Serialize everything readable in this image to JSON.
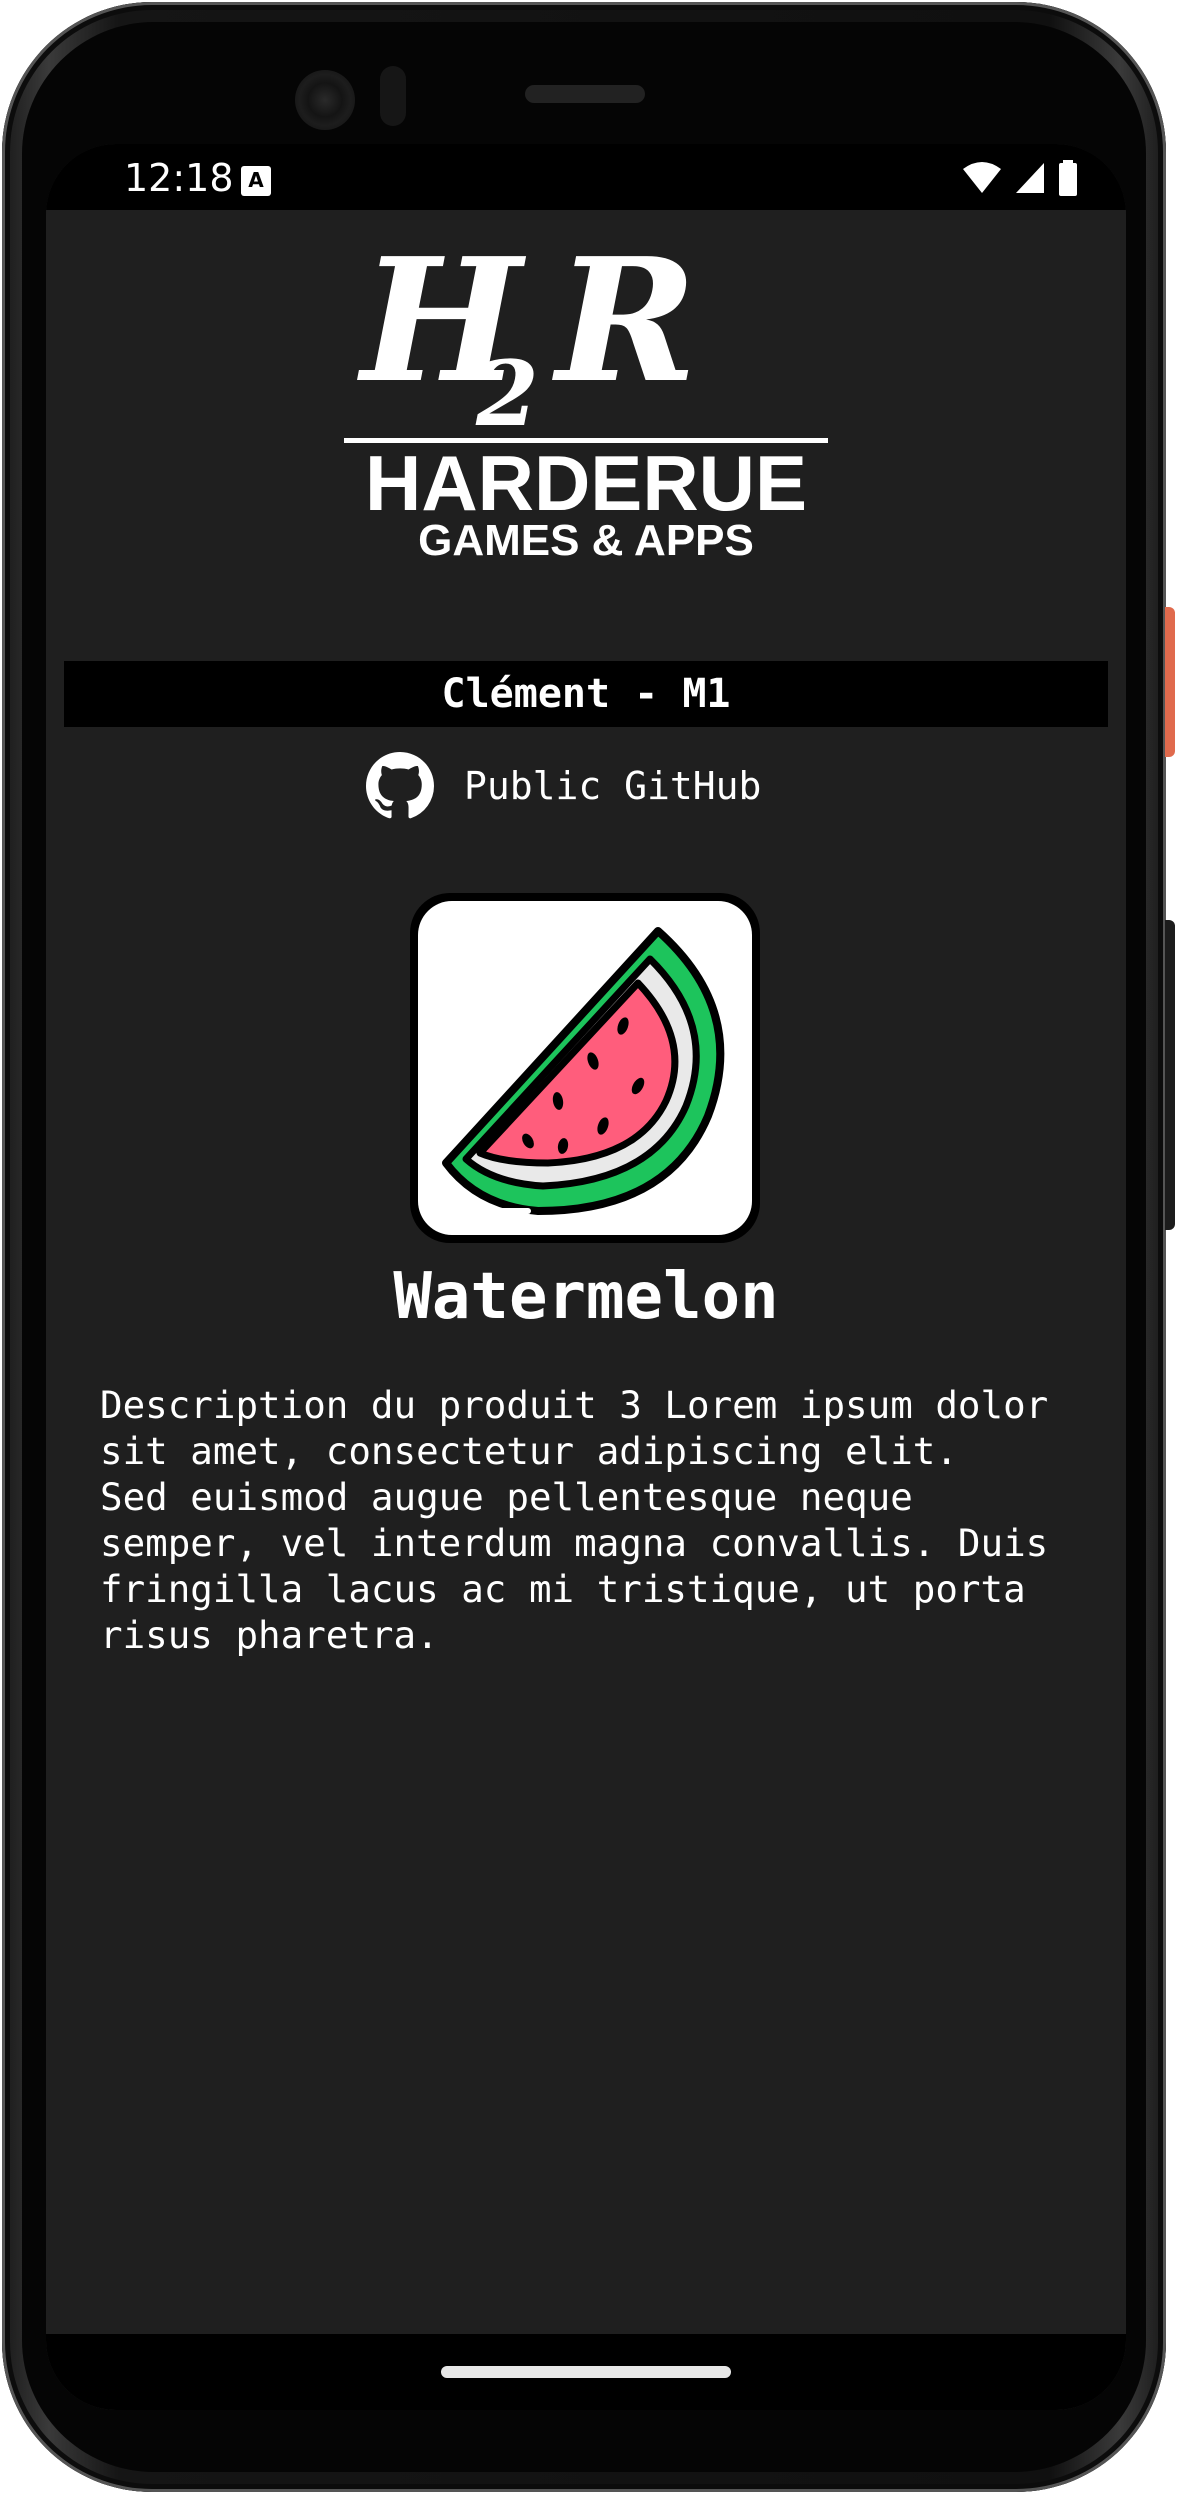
{
  "status_bar": {
    "time": "12:18",
    "notification_icon": "A",
    "icons": [
      "wifi-icon",
      "cell-signal-icon",
      "battery-icon"
    ]
  },
  "header": {
    "logo_mark": "H",
    "logo_sub": "2",
    "logo_mark2": "R",
    "brand": "HARDERUE",
    "tagline": "GAMES & APPS"
  },
  "user_bar": {
    "label": "Clément - M1"
  },
  "github": {
    "icon": "github-icon",
    "label": "Public GitHub"
  },
  "product": {
    "image_icon": "watermelon-icon",
    "title": "Watermelon",
    "description": "Description du produit 3 Lorem ipsum dolor\nsit amet, consectetur adipiscing elit.\nSed euismod augue pellentesque neque\nsemper, vel interdum magna convallis. Duis\nfringilla lacus ac mi tristique, ut porta\nrisus pharetra."
  },
  "colors": {
    "background": "#1f1f1f",
    "bar": "#000000",
    "text": "#ffffff",
    "watermelon_flesh": "#ff5d7c",
    "watermelon_rind": "#1dc45c"
  }
}
